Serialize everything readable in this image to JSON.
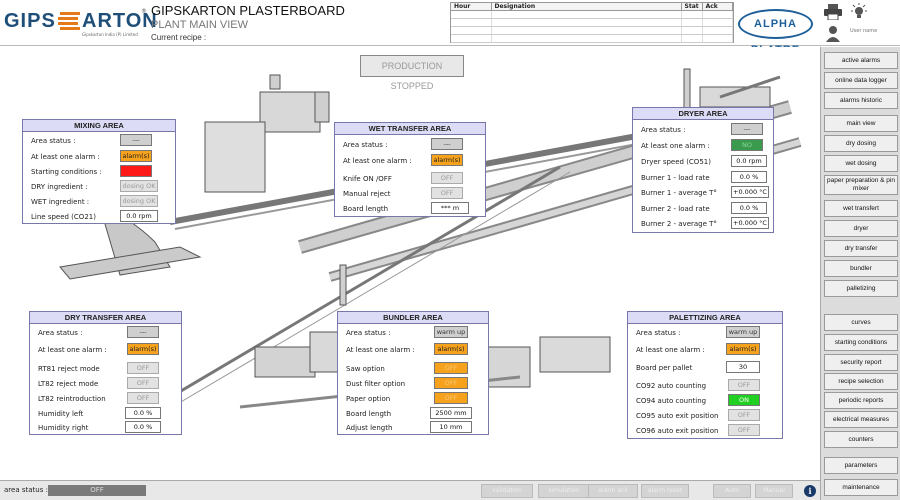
{
  "header": {
    "logo_text": "GIPS ARTON",
    "logo_subtitle": "Gipskarton India (P) Limited",
    "title": "GIPSKARTON PLASTERBOARD",
    "subtitle": "PLANT MAIN VIEW",
    "current_recipe_label": "Current recipe :",
    "alarm_columns": [
      "Hour",
      "Designation",
      "Stat",
      "Ack"
    ],
    "partner_logo": "ALPHA PLATRE",
    "user_name": "User name",
    "icons": [
      "printer-icon",
      "lightbulb-icon",
      "user-icon"
    ]
  },
  "production_status": "PRODUCTION STOPPED",
  "colors": {
    "panel_header": "#dcdcf6",
    "orange": "#f6a21c",
    "red": "#ff1a1a",
    "green": "#20d020"
  },
  "panels": {
    "mixing": {
      "title": "MIXING AREA",
      "rows": [
        {
          "label": "Area status :",
          "value": "---"
        },
        {
          "label": "At least one alarm :",
          "value": "alarm(s)"
        },
        {
          "label": "Starting conditions :",
          "value": ""
        },
        {
          "label": "DRY ingredient :",
          "value": "dosing OK"
        },
        {
          "label": "WET ingredient :",
          "value": "dosing OK"
        },
        {
          "label": "Line speed (CO21)",
          "value": "0.0 rpm"
        }
      ]
    },
    "wet_transfer": {
      "title": "WET TRANSFER AREA",
      "rows": [
        {
          "label": "Area status :",
          "value": "---"
        },
        {
          "label": "At least one alarm :",
          "value": "alarm(s)"
        },
        {
          "label": "Knife ON /OFF",
          "value": "OFF"
        },
        {
          "label": "Manual reject",
          "value": "OFF"
        },
        {
          "label": "Board length",
          "value": "*** m"
        }
      ]
    },
    "dryer": {
      "title": "DRYER AREA",
      "rows": [
        {
          "label": "Area status :",
          "value": "---"
        },
        {
          "label": "At least one alarm :",
          "value": "NO"
        },
        {
          "label": "Dryer speed (CO51)",
          "value": "0.0 rpm"
        },
        {
          "label": "Burner 1 - load rate",
          "value": "0.0 %"
        },
        {
          "label": "Burner 1 - average T°",
          "value": "+0.000 °C"
        },
        {
          "label": "Burner 2 - load rate",
          "value": "0.0 %"
        },
        {
          "label": "Burner 2 - average T°",
          "value": "+0.000 °C"
        }
      ]
    },
    "dry_transfer": {
      "title": "DRY TRANSFER AREA",
      "rows": [
        {
          "label": "Area status :",
          "value": "---"
        },
        {
          "label": "At least one alarm :",
          "value": "alarm(s)"
        },
        {
          "label": "RT81 reject mode",
          "value": "OFF"
        },
        {
          "label": "LT82 reject mode",
          "value": "OFF"
        },
        {
          "label": "LT82 reintroduction",
          "value": "OFF"
        },
        {
          "label": "Humidity left",
          "value": "0.0 %"
        },
        {
          "label": "Humidity right",
          "value": "0.0 %"
        }
      ]
    },
    "bundler": {
      "title": "BUNDLER AREA",
      "rows": [
        {
          "label": "Area status :",
          "value": "warm up"
        },
        {
          "label": "At least one alarm :",
          "value": "alarm(s)"
        },
        {
          "label": "Saw option",
          "value": "OFF"
        },
        {
          "label": "Dust filter option",
          "value": "OFF"
        },
        {
          "label": "Paper option",
          "value": "OFF"
        },
        {
          "label": "Board length",
          "value": "2500 mm"
        },
        {
          "label": "Adjust length",
          "value": "10 mm"
        }
      ]
    },
    "palettizing": {
      "title": "PALETTIZING AREA",
      "rows": [
        {
          "label": "Area status :",
          "value": "warm up"
        },
        {
          "label": "At least one alarm :",
          "value": "alarm(s)"
        },
        {
          "label": "Board per pallet",
          "value": "30"
        },
        {
          "label": "CO92 auto counting",
          "value": "OFF"
        },
        {
          "label": "CO94 auto counting",
          "value": "ON"
        },
        {
          "label": "CO95 auto exit position",
          "value": "OFF"
        },
        {
          "label": "CO96 auto exit position",
          "value": "OFF"
        }
      ]
    }
  },
  "sidebar": {
    "group1": [
      "active alarms",
      "online data logger",
      "alarms historic"
    ],
    "group2": [
      "main view",
      "dry dosing",
      "wet dosing",
      "paper preparation & pin mixer",
      "wet transfert",
      "dryer",
      "dry transfer",
      "bundler",
      "palletizing"
    ],
    "group3": [
      "curves",
      "starting conditions",
      "security report",
      "recipe selection",
      "periodic reports",
      "electrical measures",
      "counters"
    ],
    "group4": [
      "parameters",
      "maintenance"
    ]
  },
  "footer": {
    "area_status_label": "area status :",
    "area_status_value": "OFF",
    "buttons": [
      "validation",
      "simulation",
      "alarm ack",
      "alarm reset",
      "Auto",
      "Manual"
    ],
    "info_icon": "i"
  }
}
